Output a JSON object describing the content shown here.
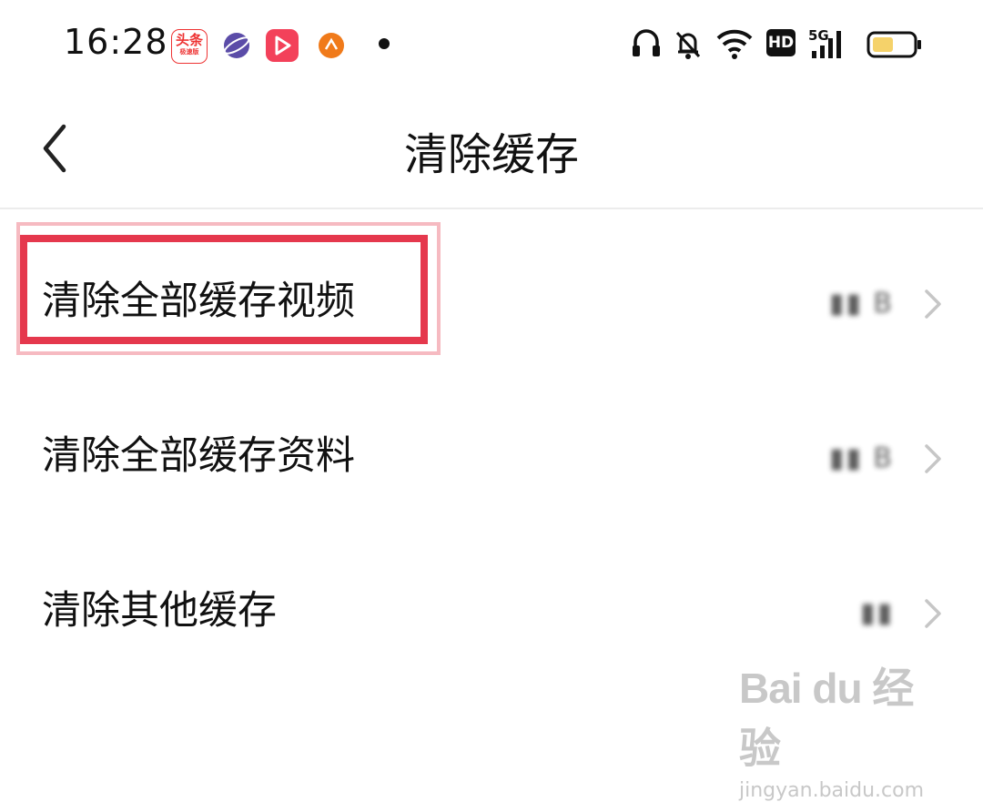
{
  "status_bar": {
    "time": "16:28",
    "apps": [
      {
        "icon": "toutiao-app-icon",
        "label": "头条",
        "sublabel": "极速版"
      },
      {
        "icon": "planet-app-icon"
      },
      {
        "icon": "play-app-icon"
      },
      {
        "icon": "orange-app-icon"
      }
    ],
    "indicators": [
      "headset-icon",
      "bell-muted-icon",
      "wifi-icon",
      "hd-icon",
      "5g-signal-icon",
      "battery-icon"
    ],
    "hd_label": "HD",
    "network_label": "5G"
  },
  "header": {
    "title": "清除缓存",
    "back_icon": "chevron-left-icon"
  },
  "list": {
    "items": [
      {
        "label": "清除全部缓存视频",
        "value": "▮▮ B",
        "highlighted": true
      },
      {
        "label": "清除全部缓存资料",
        "value": "▮▮ B",
        "highlighted": false
      },
      {
        "label": "清除其他缓存",
        "value": "▮▮",
        "highlighted": false
      }
    ]
  },
  "watermark": {
    "brand": "Bai du 经验",
    "url": "jingyan.baidu.com"
  },
  "colors": {
    "highlight": "#e5384d",
    "text": "#111111",
    "chevron": "#c6c6c6",
    "divider": "#ececec"
  }
}
